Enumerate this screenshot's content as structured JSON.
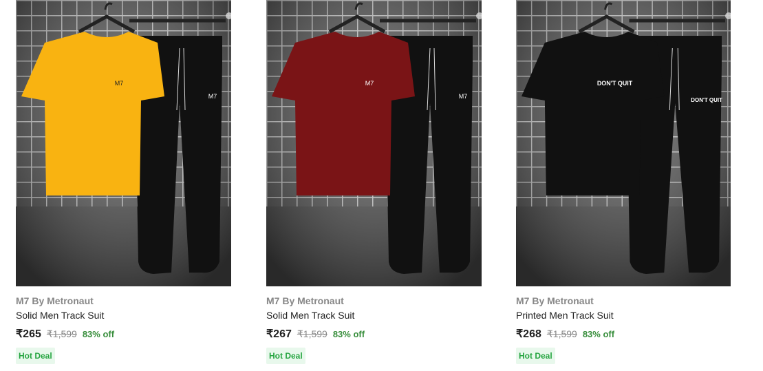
{
  "products": [
    {
      "brand": "M7 By Metronaut",
      "title": "Solid Men Track Suit",
      "price": "₹265",
      "mrp": "₹1,599",
      "discount": "83% off",
      "badge": "Hot Deal",
      "shirt_color": "#f9b311",
      "shirt_logo": "M7",
      "pants_logo": "M7"
    },
    {
      "brand": "M7 By Metronaut",
      "title": "Solid Men Track Suit",
      "price": "₹267",
      "mrp": "₹1,599",
      "discount": "83% off",
      "badge": "Hot Deal",
      "shirt_color": "#7a1416",
      "shirt_logo": "M7",
      "pants_logo": "M7"
    },
    {
      "brand": "M7 By Metronaut",
      "title": "Printed Men Track Suit",
      "price": "₹268",
      "mrp": "₹1,599",
      "discount": "83% off",
      "badge": "Hot Deal",
      "shirt_color": "#111111",
      "shirt_logo": "DON'T QUIT",
      "pants_logo": "DON'T QUIT"
    }
  ]
}
